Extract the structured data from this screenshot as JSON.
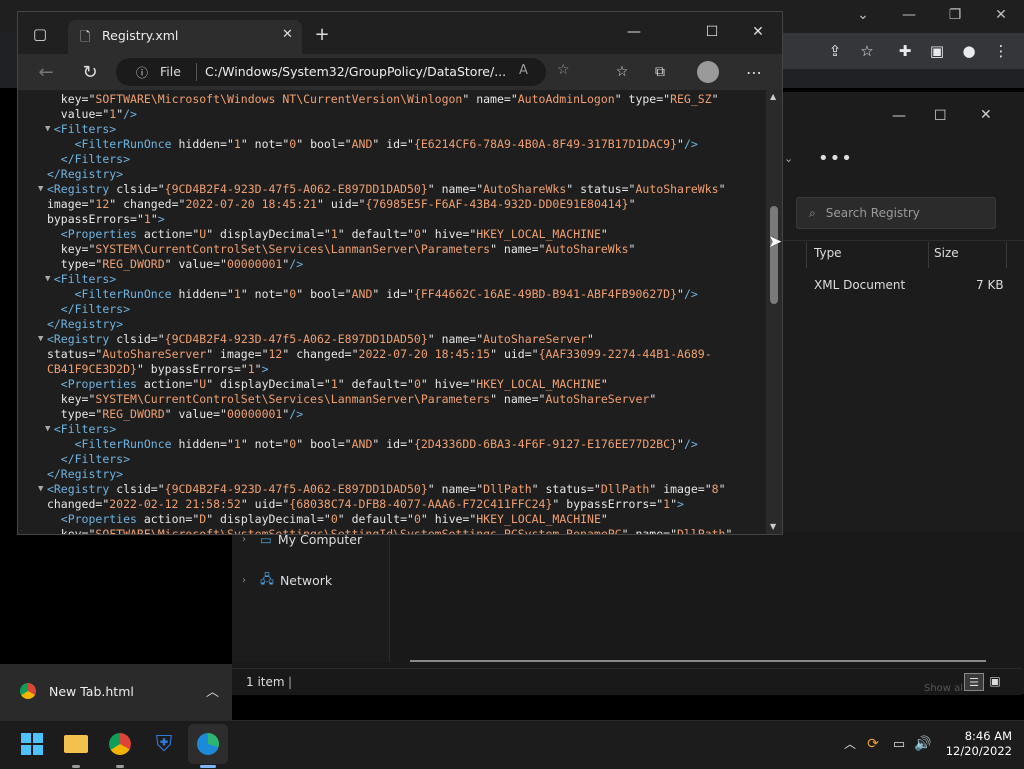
{
  "edge": {
    "tab_title": "Registry.xml",
    "address_prefix": "File",
    "address": "C:/Windows/System32/GroupPolicy/DataStore/...",
    "lines": [
      {
        "indent": "  ",
        "tri": "",
        "parts": [
          [
            "attr",
            "key=\""
          ],
          [
            "val",
            "SOFTWARE\\Microsoft\\Windows NT\\CurrentVersion\\Winlogon"
          ],
          [
            "attr",
            "\" name=\""
          ],
          [
            "val",
            "AutoAdminLogon"
          ],
          [
            "attr",
            "\" type=\""
          ],
          [
            "val",
            "REG_SZ"
          ],
          [
            "attr",
            "\""
          ]
        ]
      },
      {
        "indent": "  ",
        "tri": "",
        "parts": [
          [
            "attr",
            "value=\""
          ],
          [
            "val",
            "1"
          ],
          [
            "attr",
            "\""
          ],
          [
            "tag",
            "/>"
          ]
        ]
      },
      {
        "indent": " ",
        "tri": "▼",
        "parts": [
          [
            "tag",
            "<Filters>"
          ]
        ]
      },
      {
        "indent": "    ",
        "tri": "",
        "parts": [
          [
            "tag",
            "<FilterRunOnce "
          ],
          [
            "attr",
            "hidden=\""
          ],
          [
            "val",
            "1"
          ],
          [
            "attr",
            "\" not=\""
          ],
          [
            "val",
            "0"
          ],
          [
            "attr",
            "\" bool=\""
          ],
          [
            "val",
            "AND"
          ],
          [
            "attr",
            "\" id=\""
          ],
          [
            "val",
            "{E6214CF6-78A9-4B0A-8F49-317B17D1DAC9}"
          ],
          [
            "attr",
            "\""
          ],
          [
            "tag",
            "/>"
          ]
        ]
      },
      {
        "indent": "  ",
        "tri": "",
        "parts": [
          [
            "tag",
            "</Filters>"
          ]
        ]
      },
      {
        "indent": "",
        "tri": "",
        "parts": [
          [
            "tag",
            "</Registry>"
          ]
        ]
      },
      {
        "indent": "",
        "tri": "▼",
        "parts": [
          [
            "tag",
            "<Registry "
          ],
          [
            "attr",
            "clsid=\""
          ],
          [
            "val",
            "{9CD4B2F4-923D-47f5-A062-E897DD1DAD50}"
          ],
          [
            "attr",
            "\" name=\""
          ],
          [
            "val",
            "AutoShareWks"
          ],
          [
            "attr",
            "\" status=\""
          ],
          [
            "val",
            "AutoShareWks"
          ],
          [
            "attr",
            "\""
          ]
        ]
      },
      {
        "indent": "",
        "tri": "",
        "parts": [
          [
            "attr",
            "image=\""
          ],
          [
            "val",
            "12"
          ],
          [
            "attr",
            "\" changed=\""
          ],
          [
            "val",
            "2022-07-20 18:45:21"
          ],
          [
            "attr",
            "\" uid=\""
          ],
          [
            "val",
            "{76985E5F-F6AF-43B4-932D-DD0E91E80414}"
          ],
          [
            "attr",
            "\""
          ]
        ]
      },
      {
        "indent": "",
        "tri": "",
        "parts": [
          [
            "attr",
            "bypassErrors=\""
          ],
          [
            "val",
            "1"
          ],
          [
            "attr",
            "\""
          ],
          [
            "tag",
            ">"
          ]
        ]
      },
      {
        "indent": "  ",
        "tri": "",
        "parts": [
          [
            "tag",
            "<Properties "
          ],
          [
            "attr",
            "action=\""
          ],
          [
            "val",
            "U"
          ],
          [
            "attr",
            "\" displayDecimal=\""
          ],
          [
            "val",
            "1"
          ],
          [
            "attr",
            "\" default=\""
          ],
          [
            "val",
            "0"
          ],
          [
            "attr",
            "\" hive=\""
          ],
          [
            "val",
            "HKEY_LOCAL_MACHINE"
          ],
          [
            "attr",
            "\""
          ]
        ]
      },
      {
        "indent": "  ",
        "tri": "",
        "parts": [
          [
            "attr",
            "key=\""
          ],
          [
            "val",
            "SYSTEM\\CurrentControlSet\\Services\\LanmanServer\\Parameters"
          ],
          [
            "attr",
            "\" name=\""
          ],
          [
            "val",
            "AutoShareWks"
          ],
          [
            "attr",
            "\""
          ]
        ]
      },
      {
        "indent": "  ",
        "tri": "",
        "parts": [
          [
            "attr",
            "type=\""
          ],
          [
            "val",
            "REG_DWORD"
          ],
          [
            "attr",
            "\" value=\""
          ],
          [
            "val",
            "00000001"
          ],
          [
            "attr",
            "\""
          ],
          [
            "tag",
            "/>"
          ]
        ]
      },
      {
        "indent": " ",
        "tri": "▼",
        "parts": [
          [
            "tag",
            "<Filters>"
          ]
        ]
      },
      {
        "indent": "    ",
        "tri": "",
        "parts": [
          [
            "tag",
            "<FilterRunOnce "
          ],
          [
            "attr",
            "hidden=\""
          ],
          [
            "val",
            "1"
          ],
          [
            "attr",
            "\" not=\""
          ],
          [
            "val",
            "0"
          ],
          [
            "attr",
            "\" bool=\""
          ],
          [
            "val",
            "AND"
          ],
          [
            "attr",
            "\" id=\""
          ],
          [
            "val",
            "{FF44662C-16AE-49BD-B941-ABF4FB90627D}"
          ],
          [
            "attr",
            "\""
          ],
          [
            "tag",
            "/>"
          ]
        ]
      },
      {
        "indent": "  ",
        "tri": "",
        "parts": [
          [
            "tag",
            "</Filters>"
          ]
        ]
      },
      {
        "indent": "",
        "tri": "",
        "parts": [
          [
            "tag",
            "</Registry>"
          ]
        ]
      },
      {
        "indent": "",
        "tri": "▼",
        "parts": [
          [
            "tag",
            "<Registry "
          ],
          [
            "attr",
            "clsid=\""
          ],
          [
            "val",
            "{9CD4B2F4-923D-47f5-A062-E897DD1DAD50}"
          ],
          [
            "attr",
            "\" name=\""
          ],
          [
            "val",
            "AutoShareServer"
          ],
          [
            "attr",
            "\""
          ]
        ]
      },
      {
        "indent": "",
        "tri": "",
        "parts": [
          [
            "attr",
            "status=\""
          ],
          [
            "val",
            "AutoShareServer"
          ],
          [
            "attr",
            "\" image=\""
          ],
          [
            "val",
            "12"
          ],
          [
            "attr",
            "\" changed=\""
          ],
          [
            "val",
            "2022-07-20 18:45:15"
          ],
          [
            "attr",
            "\" uid=\""
          ],
          [
            "val",
            "{AAF33099-2274-44B1-A689-"
          ]
        ]
      },
      {
        "indent": "",
        "tri": "",
        "parts": [
          [
            "val",
            "CB41F9CE3D2D}"
          ],
          [
            "attr",
            "\" bypassErrors=\""
          ],
          [
            "val",
            "1"
          ],
          [
            "attr",
            "\""
          ],
          [
            "tag",
            ">"
          ]
        ]
      },
      {
        "indent": "  ",
        "tri": "",
        "parts": [
          [
            "tag",
            "<Properties "
          ],
          [
            "attr",
            "action=\""
          ],
          [
            "val",
            "U"
          ],
          [
            "attr",
            "\" displayDecimal=\""
          ],
          [
            "val",
            "1"
          ],
          [
            "attr",
            "\" default=\""
          ],
          [
            "val",
            "0"
          ],
          [
            "attr",
            "\" hive=\""
          ],
          [
            "val",
            "HKEY_LOCAL_MACHINE"
          ],
          [
            "attr",
            "\""
          ]
        ]
      },
      {
        "indent": "  ",
        "tri": "",
        "parts": [
          [
            "attr",
            "key=\""
          ],
          [
            "val",
            "SYSTEM\\CurrentControlSet\\Services\\LanmanServer\\Parameters"
          ],
          [
            "attr",
            "\" name=\""
          ],
          [
            "val",
            "AutoShareServer"
          ],
          [
            "attr",
            "\""
          ]
        ]
      },
      {
        "indent": "  ",
        "tri": "",
        "parts": [
          [
            "attr",
            "type=\""
          ],
          [
            "val",
            "REG_DWORD"
          ],
          [
            "attr",
            "\" value=\""
          ],
          [
            "val",
            "00000001"
          ],
          [
            "attr",
            "\""
          ],
          [
            "tag",
            "/>"
          ]
        ]
      },
      {
        "indent": " ",
        "tri": "▼",
        "parts": [
          [
            "tag",
            "<Filters>"
          ]
        ]
      },
      {
        "indent": "    ",
        "tri": "",
        "parts": [
          [
            "tag",
            "<FilterRunOnce "
          ],
          [
            "attr",
            "hidden=\""
          ],
          [
            "val",
            "1"
          ],
          [
            "attr",
            "\" not=\""
          ],
          [
            "val",
            "0"
          ],
          [
            "attr",
            "\" bool=\""
          ],
          [
            "val",
            "AND"
          ],
          [
            "attr",
            "\" id=\""
          ],
          [
            "val",
            "{2D4336DD-6BA3-4F6F-9127-E176EE77D2BC}"
          ],
          [
            "attr",
            "\""
          ],
          [
            "tag",
            "/>"
          ]
        ]
      },
      {
        "indent": "  ",
        "tri": "",
        "parts": [
          [
            "tag",
            "</Filters>"
          ]
        ]
      },
      {
        "indent": "",
        "tri": "",
        "parts": [
          [
            "tag",
            "</Registry>"
          ]
        ]
      },
      {
        "indent": "",
        "tri": "▼",
        "parts": [
          [
            "tag",
            "<Registry "
          ],
          [
            "attr",
            "clsid=\""
          ],
          [
            "val",
            "{9CD4B2F4-923D-47f5-A062-E897DD1DAD50}"
          ],
          [
            "attr",
            "\" name=\""
          ],
          [
            "val",
            "DllPath"
          ],
          [
            "attr",
            "\" status=\""
          ],
          [
            "val",
            "DllPath"
          ],
          [
            "attr",
            "\" image=\""
          ],
          [
            "val",
            "8"
          ],
          [
            "attr",
            "\""
          ]
        ]
      },
      {
        "indent": "",
        "tri": "",
        "parts": [
          [
            "attr",
            "changed=\""
          ],
          [
            "val",
            "2022-02-12 21:58:52"
          ],
          [
            "attr",
            "\" uid=\""
          ],
          [
            "val",
            "{68038C74-DFB8-4077-AAA6-F72C411FFC24}"
          ],
          [
            "attr",
            "\" bypassErrors=\""
          ],
          [
            "val",
            "1"
          ],
          [
            "attr",
            "\""
          ],
          [
            "tag",
            ">"
          ]
        ]
      },
      {
        "indent": "  ",
        "tri": "",
        "parts": [
          [
            "tag",
            "<Properties "
          ],
          [
            "attr",
            "action=\""
          ],
          [
            "val",
            "D"
          ],
          [
            "attr",
            "\" displayDecimal=\""
          ],
          [
            "val",
            "0"
          ],
          [
            "attr",
            "\" default=\""
          ],
          [
            "val",
            "0"
          ],
          [
            "attr",
            "\" hive=\""
          ],
          [
            "val",
            "HKEY_LOCAL_MACHINE"
          ],
          [
            "attr",
            "\""
          ]
        ]
      },
      {
        "indent": "  ",
        "tri": "",
        "parts": [
          [
            "attr",
            "key=\""
          ],
          [
            "val",
            "SOFTWARE\\Microsoft\\SystemSettings\\SettingId\\SystemSettings_PCSystem_RenamePC"
          ],
          [
            "attr",
            "\" name=\""
          ],
          [
            "val",
            "DllPath"
          ],
          [
            "attr",
            "\""
          ]
        ]
      }
    ],
    "scroll_fraction": 0.34
  },
  "explorer": {
    "search_placeholder": "Search Registry",
    "columns": [
      "Type",
      "Size"
    ],
    "row": {
      "type": "XML Document",
      "size": "7 KB"
    },
    "nav": [
      {
        "label": "My Computer",
        "icon": "computer-icon"
      },
      {
        "label": "Network",
        "icon": "network-icon"
      }
    ],
    "status": "1 item",
    "show_all": "Show all"
  },
  "download": {
    "file": "New Tab.html"
  },
  "taskbar": {
    "time": "8:46 AM",
    "date": "12/20/2022",
    "apps": [
      "start-icon",
      "file-explorer-icon",
      "chrome-icon",
      "defender-icon",
      "edge-icon"
    ]
  },
  "colors": {
    "tag": "#6fb3e0",
    "attr": "#e7e7e7",
    "val": "#f0a070",
    "bg": "#1e1e1e"
  }
}
